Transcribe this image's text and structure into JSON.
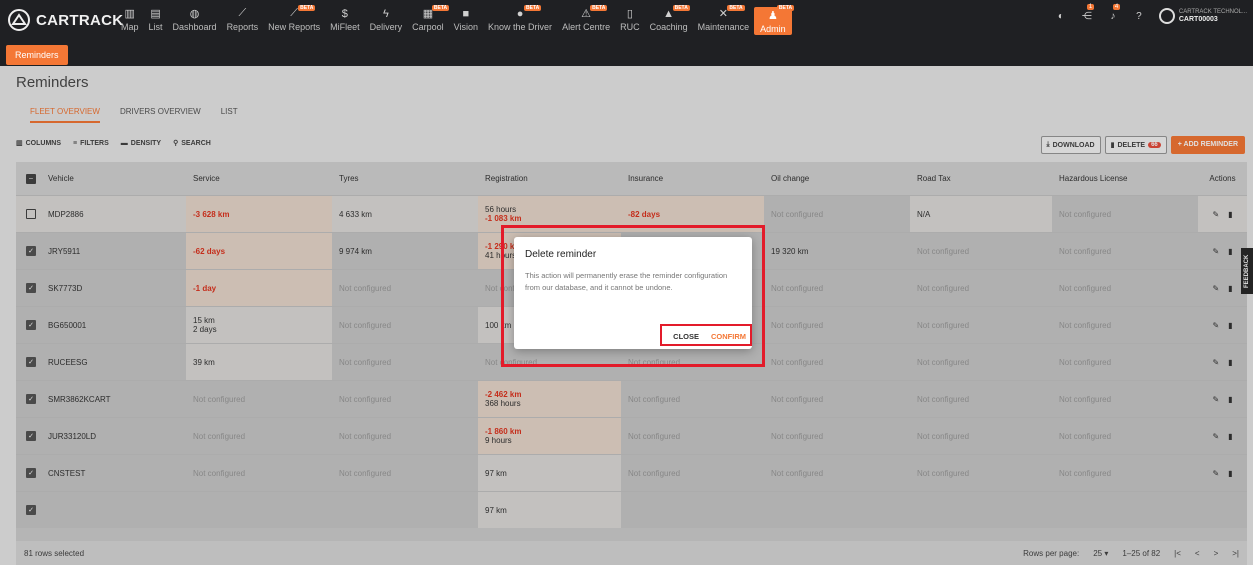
{
  "nav": {
    "brand": "CARTRACK",
    "items": [
      {
        "label": "Map",
        "icon": "map-icon",
        "beta": false
      },
      {
        "label": "List",
        "icon": "list-icon",
        "beta": false
      },
      {
        "label": "Dashboard",
        "icon": "dashboard-icon",
        "beta": false
      },
      {
        "label": "Reports",
        "icon": "reports-icon",
        "beta": false
      },
      {
        "label": "New Reports",
        "icon": "new-reports-icon",
        "beta": true
      },
      {
        "label": "MiFleet",
        "icon": "dollar-icon",
        "beta": false
      },
      {
        "label": "Delivery",
        "icon": "bolt-icon",
        "beta": false
      },
      {
        "label": "Carpool",
        "icon": "calendar-icon",
        "beta": true
      },
      {
        "label": "Vision",
        "icon": "camera-icon",
        "beta": false
      },
      {
        "label": "Know the Driver",
        "icon": "driver-icon",
        "beta": true
      },
      {
        "label": "Alert Centre",
        "icon": "alert-icon",
        "beta": true
      },
      {
        "label": "RUC",
        "icon": "document-icon",
        "beta": false
      },
      {
        "label": "Coaching",
        "icon": "coaching-icon",
        "beta": true
      },
      {
        "label": "Maintenance",
        "icon": "wrench-icon",
        "beta": true
      },
      {
        "label": "Admin",
        "icon": "admin-icon",
        "beta": true
      }
    ],
    "beta_label": "BETA",
    "badge_one": "1",
    "badge_two": "4",
    "account_company": "CARTRACK TECHNOL...",
    "account_id": "CART00003"
  },
  "subnav": {
    "active": "Reminders"
  },
  "page": {
    "title": "Reminders"
  },
  "tabs": [
    "FLEET OVERVIEW",
    "DRIVERS OVERVIEW",
    "LIST"
  ],
  "toolbar": {
    "columns": "COLUMNS",
    "filters": "FILTERS",
    "density": "DENSITY",
    "search": "SEARCH",
    "download": "DOWNLOAD",
    "delete": "DELETE",
    "delete_count": "66",
    "add": "+ ADD REMINDER"
  },
  "table": {
    "columns": [
      "Vehicle",
      "Service",
      "Tyres",
      "Registration",
      "Insurance",
      "Oil change",
      "Road Tax",
      "Hazardous License",
      "Actions"
    ],
    "rows": [
      {
        "vehicle": "MDP2886",
        "checked": false,
        "service": "-3 628 km",
        "tyres": "4 633 km",
        "reg1": "56 hours",
        "reg2": "-1 083 km",
        "insurance": "-82 days",
        "oil": "Not configured",
        "roadtax": "N/A",
        "hazard": "Not configured"
      },
      {
        "vehicle": "JRY5911",
        "checked": true,
        "service": "-62 days",
        "tyres": "9 974 km",
        "reg1": "-1 290 km",
        "reg2": "41 hours",
        "insurance": "",
        "oil": "19 320 km",
        "roadtax": "Not configured",
        "hazard": "Not configured"
      },
      {
        "vehicle": "SK7773D",
        "checked": true,
        "service": "-1 day",
        "tyres": "Not configured",
        "reg1": "Not configured",
        "reg2": "",
        "insurance": "",
        "oil": "Not configured",
        "roadtax": "Not configured",
        "hazard": "Not configured"
      },
      {
        "vehicle": "BG650001",
        "checked": true,
        "service": "15 km",
        "service2": "2 days",
        "tyres": "Not configured",
        "reg1": "100 km",
        "reg2": "",
        "insurance": "",
        "oil": "Not configured",
        "roadtax": "Not configured",
        "hazard": "Not configured"
      },
      {
        "vehicle": "RUCEESG",
        "checked": true,
        "service": "39 km",
        "tyres": "Not configured",
        "reg1": "Not configured",
        "reg2": "",
        "insurance": "Not configured",
        "oil": "Not configured",
        "roadtax": "Not configured",
        "hazard": "Not configured"
      },
      {
        "vehicle": "SMR3862KCART",
        "checked": true,
        "service": "Not configured",
        "tyres": "Not configured",
        "reg1": "-2 462 km",
        "reg2": "368 hours",
        "insurance": "Not configured",
        "oil": "Not configured",
        "roadtax": "Not configured",
        "hazard": "Not configured"
      },
      {
        "vehicle": "JUR33120LD",
        "checked": true,
        "service": "Not configured",
        "tyres": "Not configured",
        "reg1": "-1 860 km",
        "reg2": "9 hours",
        "insurance": "Not configured",
        "oil": "Not configured",
        "roadtax": "Not configured",
        "hazard": "Not configured"
      },
      {
        "vehicle": "CNSTEST",
        "checked": true,
        "service": "Not configured",
        "tyres": "Not configured",
        "reg1": "97 km",
        "reg2": "",
        "insurance": "Not configured",
        "oil": "Not configured",
        "roadtax": "Not configured",
        "hazard": "Not configured"
      },
      {
        "vehicle": "",
        "checked": true,
        "service": "",
        "tyres": "",
        "reg1": "97 km",
        "reg2": "",
        "insurance": "",
        "oil": "",
        "roadtax": "",
        "hazard": ""
      }
    ]
  },
  "footer": {
    "selected": "81 rows selected",
    "rows_per_page_label": "Rows per page:",
    "rows_per_page": "25",
    "range": "1–25 of 82"
  },
  "feedback": "FEEDBACK",
  "dialog": {
    "title": "Delete reminder",
    "body": "This action will permanently erase the reminder configuration from our database, and it cannot be undone.",
    "close": "CLOSE",
    "confirm": "CONFIRM"
  },
  "colors": {
    "accent": "#f47735",
    "danger": "#e0341f",
    "highlight": "#e31b2a"
  }
}
